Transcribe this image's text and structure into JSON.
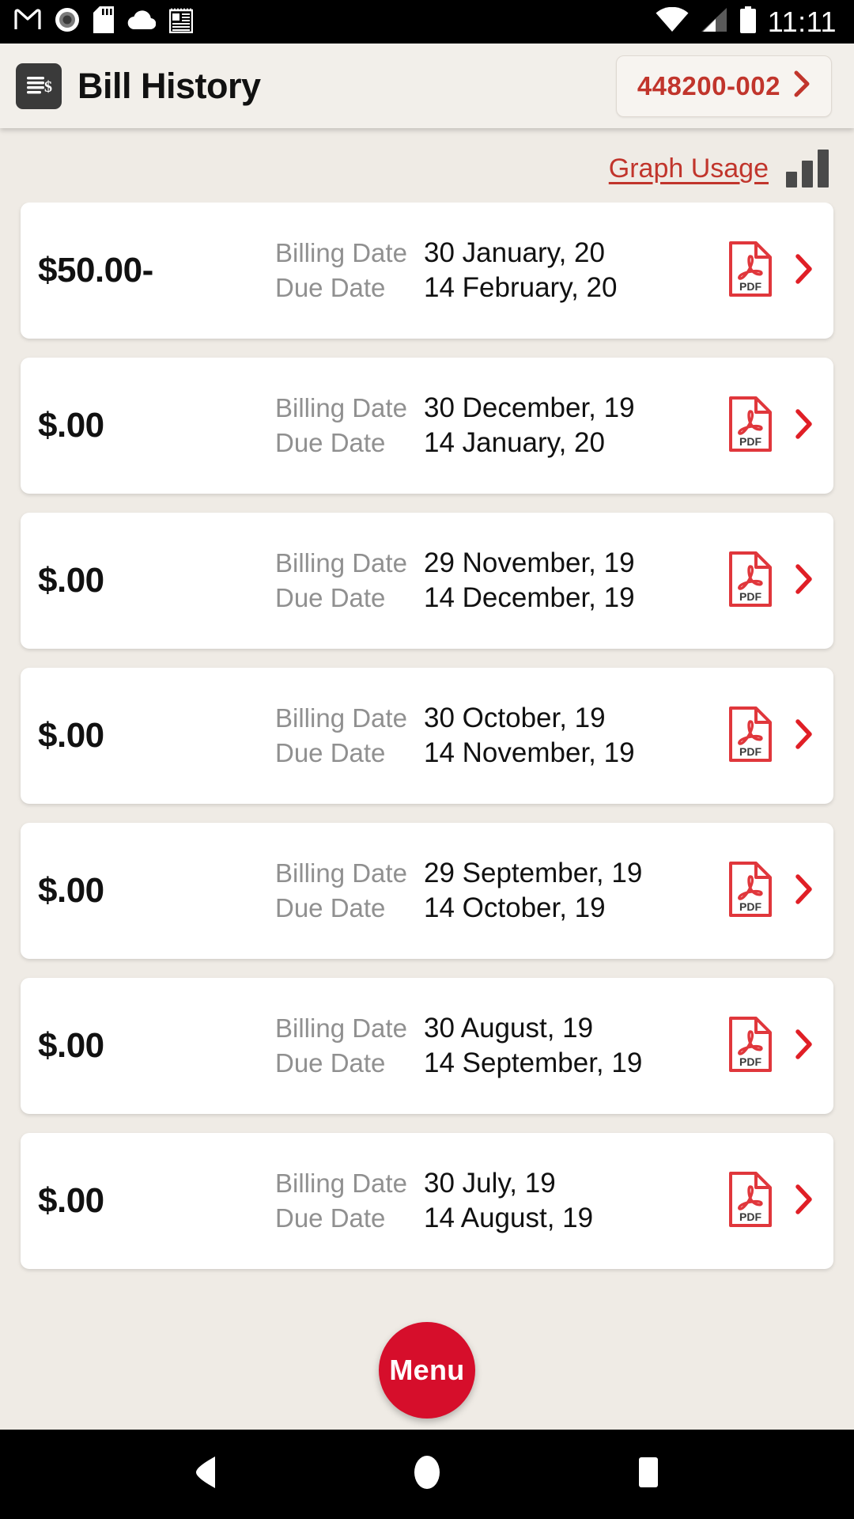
{
  "status_bar": {
    "time": "11:11",
    "left_icons": [
      "gmail-icon",
      "screen-record-icon",
      "sd-card-icon",
      "cloud-icon",
      "notes-icon"
    ],
    "right_icons": [
      "wifi-icon",
      "cellular-signal-icon",
      "battery-icon"
    ]
  },
  "header": {
    "icon": "bill-document-icon",
    "title": "Bill History",
    "account_button": {
      "number": "448200-002",
      "chevron": "chevron-right-icon"
    }
  },
  "graph_usage": {
    "label": "Graph Usage",
    "icon": "bar-chart-icon"
  },
  "labels": {
    "billing_date": "Billing Date",
    "due_date": "Due Date"
  },
  "bills": [
    {
      "amount": "$50.00-",
      "billing_date": "30 January, 20",
      "due_date": "14 February, 20",
      "pdf_icon": "pdf-file-icon",
      "chevron": "chevron-right-icon"
    },
    {
      "amount": "$.00",
      "billing_date": "30 December, 19",
      "due_date": "14 January, 20",
      "pdf_icon": "pdf-file-icon",
      "chevron": "chevron-right-icon"
    },
    {
      "amount": "$.00",
      "billing_date": "29 November, 19",
      "due_date": "14 December, 19",
      "pdf_icon": "pdf-file-icon",
      "chevron": "chevron-right-icon"
    },
    {
      "amount": "$.00",
      "billing_date": "30 October, 19",
      "due_date": "14 November, 19",
      "pdf_icon": "pdf-file-icon",
      "chevron": "chevron-right-icon"
    },
    {
      "amount": "$.00",
      "billing_date": "29 September, 19",
      "due_date": "14 October, 19",
      "pdf_icon": "pdf-file-icon",
      "chevron": "chevron-right-icon"
    },
    {
      "amount": "$.00",
      "billing_date": "30 August, 19",
      "due_date": "14 September, 19",
      "pdf_icon": "pdf-file-icon",
      "chevron": "chevron-right-icon"
    },
    {
      "amount": "$.00",
      "billing_date": "30 July, 19",
      "due_date": "14 August, 19",
      "pdf_icon": "pdf-file-icon",
      "chevron": "chevron-right-icon"
    }
  ],
  "fab": {
    "label": "Menu"
  },
  "nav_bar": {
    "back": "back-triangle-icon",
    "home": "home-circle-icon",
    "recents": "recents-square-icon"
  },
  "colors": {
    "brand_red": "#C1352C",
    "fab_red": "#D60E2B",
    "chevron_red": "#E01F26",
    "background": "#EFEBE5",
    "card": "#FFFFFF",
    "label_gray": "#909090",
    "icon_dark": "#3A3A3A"
  }
}
